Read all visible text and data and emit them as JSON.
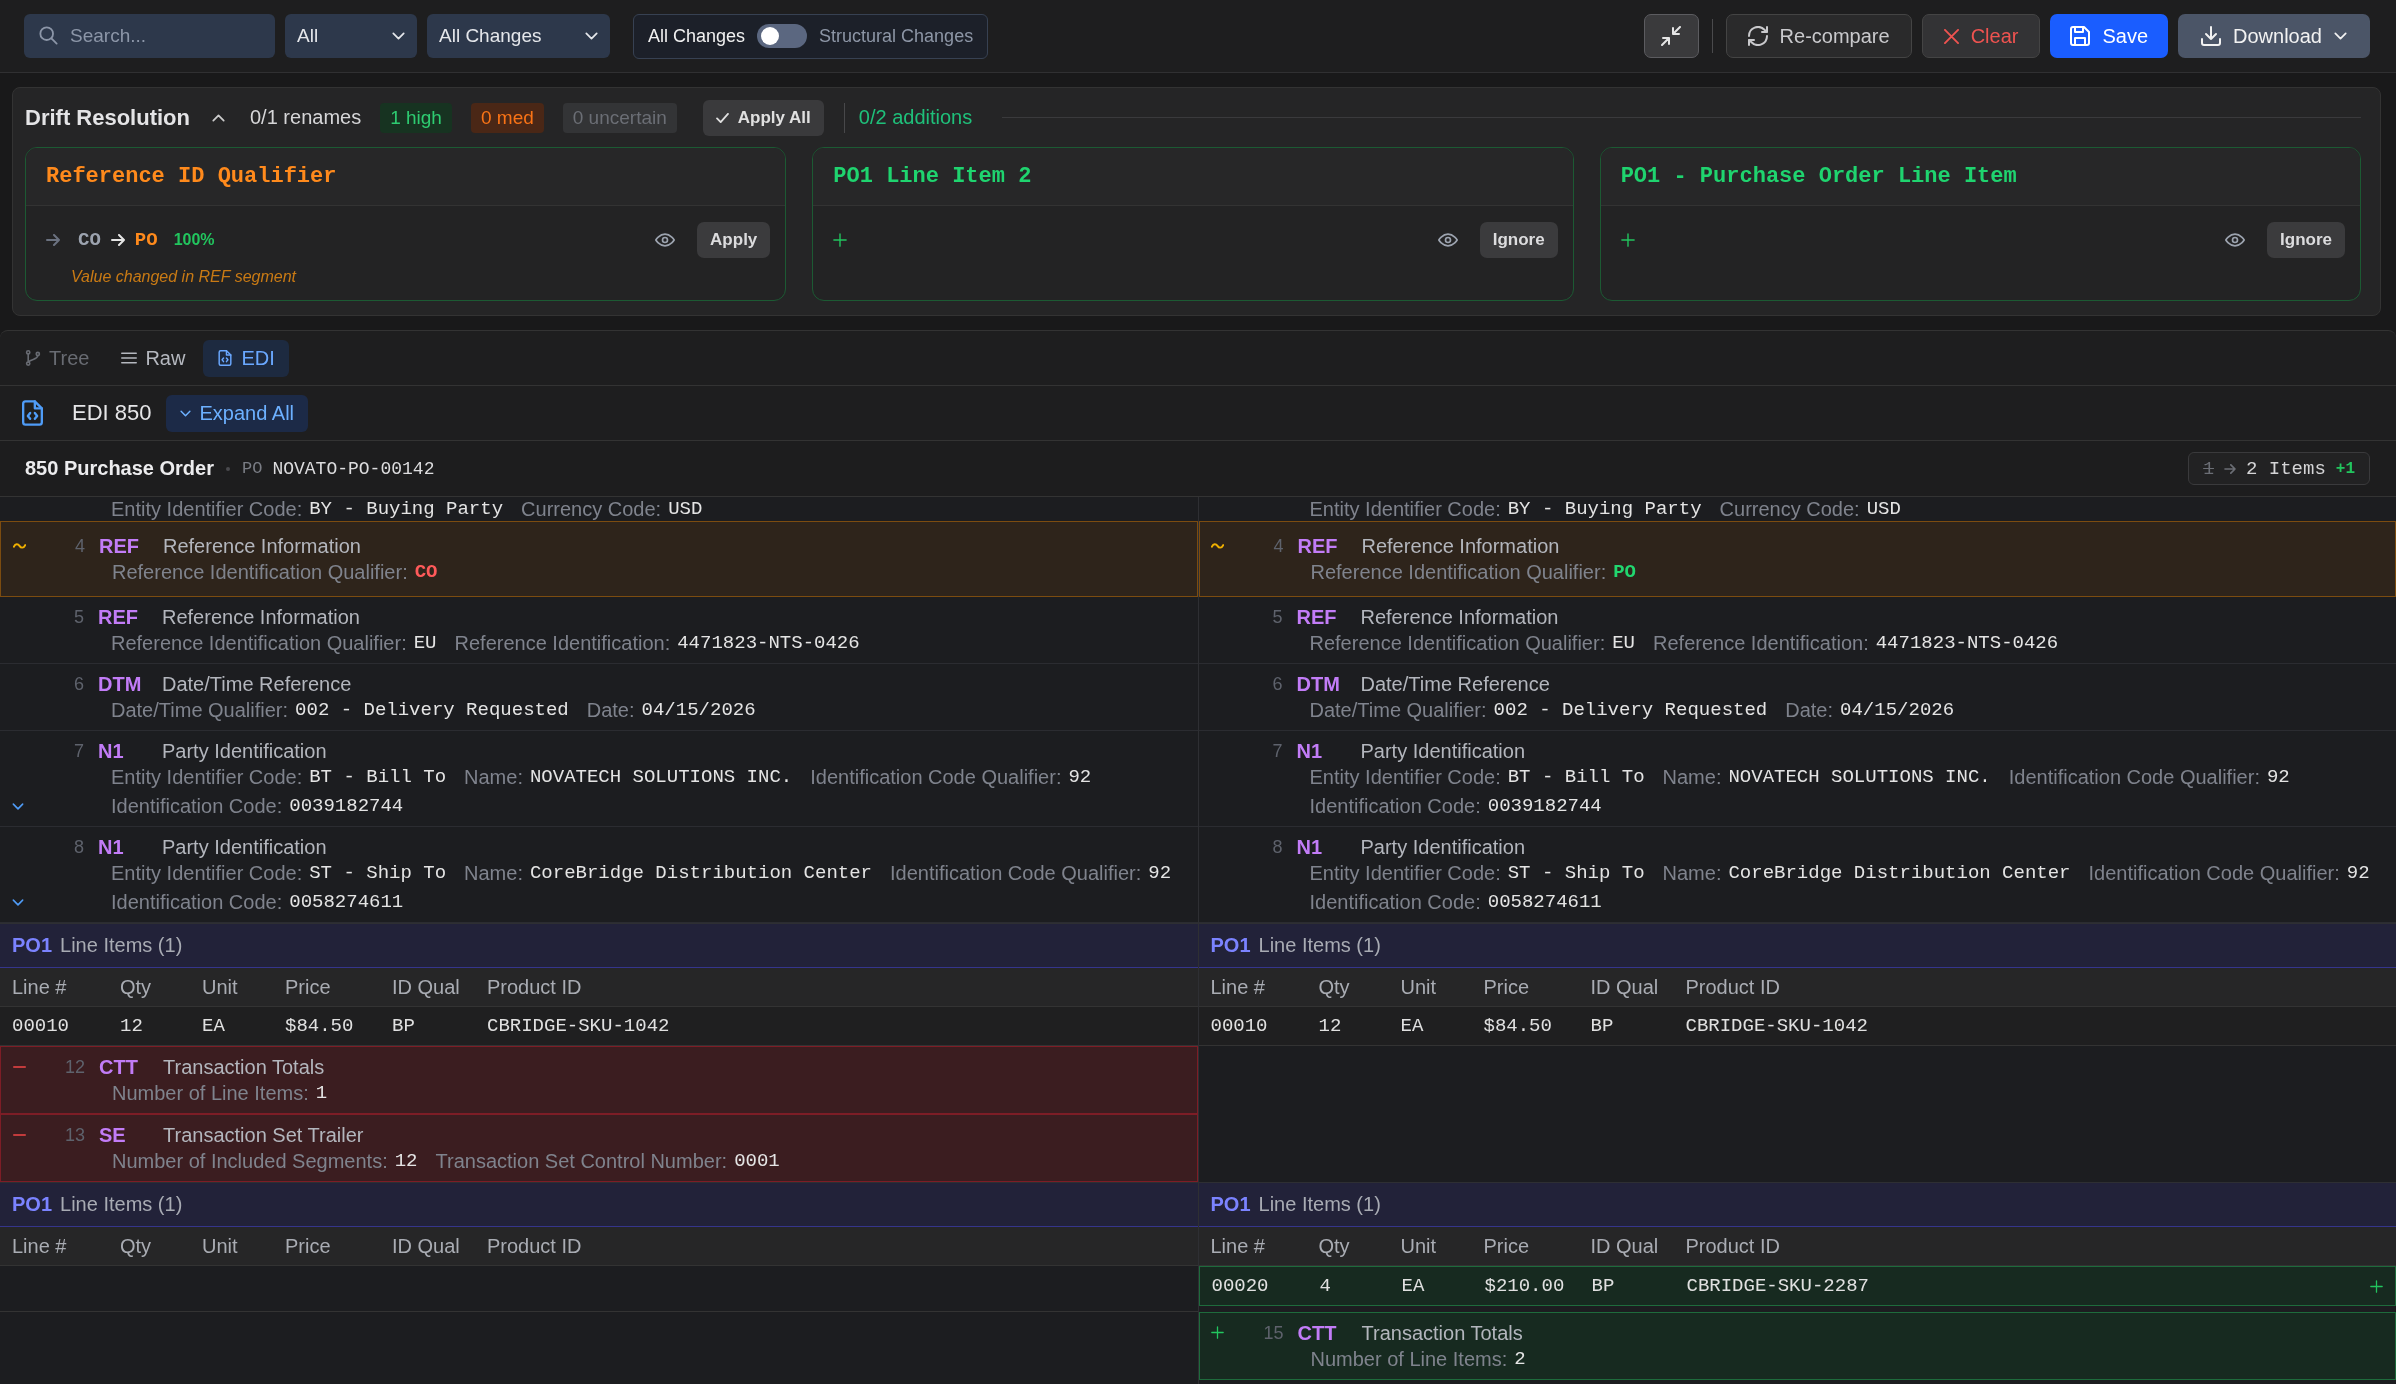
{
  "toolbar": {
    "search": {
      "placeholder": "Search..."
    },
    "filters": [
      {
        "value": "All"
      },
      {
        "value": "All Changes"
      }
    ],
    "mode_switch": {
      "left_label": "All Changes",
      "right_label": "Structural Changes",
      "on": false
    },
    "buttons": [
      {
        "kind": "collapse"
      },
      {
        "kind": "recompare",
        "label": "Re-compare"
      },
      {
        "kind": "clear",
        "label": "Clear"
      },
      {
        "kind": "save",
        "label": "Save"
      },
      {
        "kind": "download",
        "label": "Download"
      }
    ]
  },
  "drift_resolution": {
    "title": "Drift Resolution",
    "expanded": true,
    "renames": "0/1 renames",
    "badges": [
      {
        "kind": "high",
        "label": "1 high"
      },
      {
        "kind": "med",
        "label": "0 med"
      },
      {
        "kind": "uncertain",
        "label": "0 uncertain"
      }
    ],
    "apply_all": "Apply All",
    "additions": "0/2 additions",
    "cards": [
      {
        "kind": "rename",
        "title": "Reference ID Qualifier",
        "from": "CO",
        "to": "PO",
        "confidence": "100%",
        "action": "Apply",
        "note": "Value changed in REF segment"
      },
      {
        "kind": "addition",
        "title": "PO1 Line Item 2",
        "action": "Ignore"
      },
      {
        "kind": "addition",
        "title": "PO1 - Purchase Order Line Item",
        "action": "Ignore"
      }
    ]
  },
  "view_tabs": [
    {
      "kind": "tree",
      "label": "Tree",
      "selected": false,
      "disabled": true
    },
    {
      "kind": "raw",
      "label": "Raw",
      "selected": false,
      "disabled": false
    },
    {
      "kind": "edi",
      "label": "EDI",
      "selected": true,
      "disabled": false
    }
  ],
  "document": {
    "title": "EDI 850",
    "expand_all": "Expand All"
  },
  "transaction": {
    "title": "850 Purchase Order",
    "ref_label": "PO",
    "ref_value": "NOVATO-PO-00142",
    "count_old": "1",
    "count_new": "2 Items",
    "count_delta": "+1"
  },
  "diff_rows": [
    {
      "kind": "continuation",
      "left": {
        "fields": [
          {
            "label": "Entity Identifier Code:",
            "value": "BY - Buying Party",
            "kind": "plain"
          },
          {
            "label": "Currency Code:",
            "value": "USD",
            "kind": "plain"
          }
        ]
      },
      "right": {
        "fields": [
          {
            "label": "Entity Identifier Code:",
            "value": "BY - Buying Party",
            "kind": "plain"
          },
          {
            "label": "Currency Code:",
            "value": "USD",
            "kind": "plain"
          }
        ]
      }
    },
    {
      "kind": "segment",
      "left": {
        "kind": "changed",
        "number": "4",
        "id": "REF",
        "name": "Reference Information",
        "expandable": false,
        "fields": [
          {
            "label": "Reference Identification Qualifier:",
            "value": "CO",
            "kind": "old"
          }
        ]
      },
      "right": {
        "kind": "changed",
        "number": "4",
        "id": "REF",
        "name": "Reference Information",
        "expandable": false,
        "fields": [
          {
            "label": "Reference Identification Qualifier:",
            "value": "PO",
            "kind": "new"
          }
        ]
      }
    },
    {
      "kind": "segment",
      "left": {
        "kind": "unchanged",
        "number": "5",
        "id": "REF",
        "name": "Reference Information",
        "expandable": false,
        "fields": [
          {
            "label": "Reference Identification Qualifier:",
            "value": "EU",
            "kind": "plain"
          },
          {
            "label": "Reference Identification:",
            "value": "4471823-NTS-0426",
            "kind": "plain"
          }
        ]
      },
      "right": {
        "kind": "unchanged",
        "number": "5",
        "id": "REF",
        "name": "Reference Information",
        "expandable": false,
        "fields": [
          {
            "label": "Reference Identification Qualifier:",
            "value": "EU",
            "kind": "plain"
          },
          {
            "label": "Reference Identification:",
            "value": "4471823-NTS-0426",
            "kind": "plain"
          }
        ]
      }
    },
    {
      "kind": "segment",
      "left": {
        "kind": "unchanged",
        "number": "6",
        "id": "DTM",
        "name": "Date/Time Reference",
        "expandable": false,
        "fields": [
          {
            "label": "Date/Time Qualifier:",
            "value": "002 - Delivery Requested",
            "kind": "plain"
          },
          {
            "label": "Date:",
            "value": "04/15/2026",
            "kind": "plain"
          }
        ]
      },
      "right": {
        "kind": "unchanged",
        "number": "6",
        "id": "DTM",
        "name": "Date/Time Reference",
        "expandable": false,
        "fields": [
          {
            "label": "Date/Time Qualifier:",
            "value": "002 - Delivery Requested",
            "kind": "plain"
          },
          {
            "label": "Date:",
            "value": "04/15/2026",
            "kind": "plain"
          }
        ]
      }
    },
    {
      "kind": "segment",
      "left": {
        "kind": "unchanged",
        "number": "7",
        "id": "N1",
        "name": "Party Identification",
        "expandable": true,
        "fields": [
          {
            "label": "Entity Identifier Code:",
            "value": "BT - Bill To",
            "kind": "plain"
          },
          {
            "label": "Name:",
            "value": "NOVATECH SOLUTIONS INC.",
            "kind": "plain"
          },
          {
            "label": "Identification Code Qualifier:",
            "value": "92",
            "kind": "plain"
          },
          {
            "label": "Identification Code:",
            "value": "0039182744",
            "kind": "plain"
          }
        ]
      },
      "right": {
        "kind": "unchanged",
        "number": "7",
        "id": "N1",
        "name": "Party Identification",
        "expandable": false,
        "fields": [
          {
            "label": "Entity Identifier Code:",
            "value": "BT - Bill To",
            "kind": "plain"
          },
          {
            "label": "Name:",
            "value": "NOVATECH SOLUTIONS INC.",
            "kind": "plain"
          },
          {
            "label": "Identification Code Qualifier:",
            "value": "92",
            "kind": "plain"
          },
          {
            "label": "Identification Code:",
            "value": "0039182744",
            "kind": "plain"
          }
        ]
      }
    },
    {
      "kind": "segment",
      "left": {
        "kind": "unchanged",
        "number": "8",
        "id": "N1",
        "name": "Party Identification",
        "expandable": true,
        "fields": [
          {
            "label": "Entity Identifier Code:",
            "value": "ST - Ship To",
            "kind": "plain"
          },
          {
            "label": "Name:",
            "value": "CoreBridge Distribution Center",
            "kind": "plain"
          },
          {
            "label": "Identification Code Qualifier:",
            "value": "92",
            "kind": "plain"
          },
          {
            "label": "Identification Code:",
            "value": "0058274611",
            "kind": "plain"
          }
        ]
      },
      "right": {
        "kind": "unchanged",
        "number": "8",
        "id": "N1",
        "name": "Party Identification",
        "expandable": false,
        "fields": [
          {
            "label": "Entity Identifier Code:",
            "value": "ST - Ship To",
            "kind": "plain"
          },
          {
            "label": "Name:",
            "value": "CoreBridge Distribution Center",
            "kind": "plain"
          },
          {
            "label": "Identification Code Qualifier:",
            "value": "92",
            "kind": "plain"
          },
          {
            "label": "Identification Code:",
            "value": "0058274611",
            "kind": "plain"
          }
        ]
      }
    },
    {
      "kind": "line_items",
      "left": {
        "id": "PO1",
        "label": "Line Items (1)"
      },
      "right": {
        "id": "PO1",
        "label": "Line Items (1)"
      }
    },
    {
      "kind": "table_header",
      "left": {
        "columns": [
          "Line #",
          "Qty",
          "Unit",
          "Price",
          "ID Qual",
          "Product ID"
        ]
      },
      "right": {
        "columns": [
          "Line #",
          "Qty",
          "Unit",
          "Price",
          "ID Qual",
          "Product ID"
        ]
      }
    },
    {
      "kind": "table_row",
      "left": {
        "kind": "unchanged",
        "cells": [
          "00010",
          "12",
          "EA",
          "$84.50",
          "BP",
          "CBRIDGE-SKU-1042"
        ]
      },
      "right": {
        "kind": "unchanged",
        "cells": [
          "00010",
          "12",
          "EA",
          "$84.50",
          "BP",
          "CBRIDGE-SKU-1042"
        ]
      }
    },
    {
      "kind": "segment",
      "left": {
        "kind": "removed",
        "number": "12",
        "id": "CTT",
        "name": "Transaction Totals",
        "expandable": false,
        "fields": [
          {
            "label": "Number of Line Items:",
            "value": "1",
            "kind": "plain"
          }
        ]
      }
    },
    {
      "kind": "segment",
      "left": {
        "kind": "removed",
        "number": "13",
        "id": "SE",
        "name": "Transaction Set Trailer",
        "expandable": false,
        "fields": [
          {
            "label": "Number of Included Segments:",
            "value": "12",
            "kind": "plain"
          },
          {
            "label": "Transaction Set Control Number:",
            "value": "0001",
            "kind": "plain"
          }
        ]
      }
    },
    {
      "kind": "line_items",
      "left": {
        "id": "PO1",
        "label": "Line Items (1)"
      },
      "right": {
        "id": "PO1",
        "label": "Line Items (1)"
      }
    },
    {
      "kind": "table_header",
      "left": {
        "columns": [
          "Line #",
          "Qty",
          "Unit",
          "Price",
          "ID Qual",
          "Product ID"
        ]
      },
      "right": {
        "columns": [
          "Line #",
          "Qty",
          "Unit",
          "Price",
          "ID Qual",
          "Product ID"
        ]
      }
    },
    {
      "kind": "table_row",
      "right": {
        "kind": "added",
        "cells": [
          "00020",
          "4",
          "EA",
          "$210.00",
          "BP",
          "CBRIDGE-SKU-2287"
        ]
      }
    },
    {
      "kind": "segment",
      "right": {
        "kind": "added",
        "number": "15",
        "id": "CTT",
        "name": "Transaction Totals",
        "expandable": false,
        "fields": [
          {
            "label": "Number of Line Items:",
            "value": "2",
            "kind": "plain"
          }
        ]
      }
    }
  ]
}
